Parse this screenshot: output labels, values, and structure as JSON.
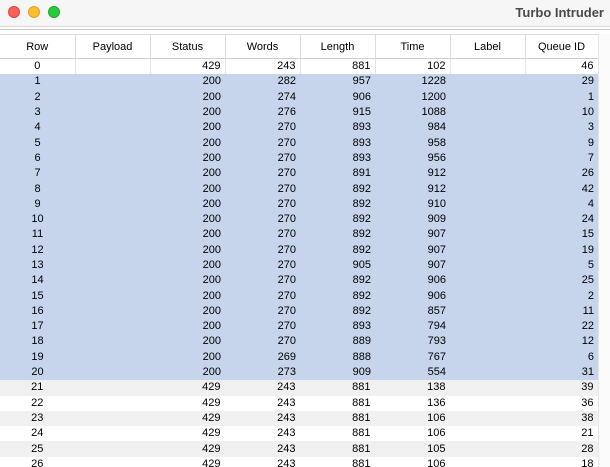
{
  "window": {
    "title": "Turbo Intruder"
  },
  "table": {
    "columns": [
      "Row",
      "Payload",
      "Status",
      "Words",
      "Length",
      "Time",
      "Label",
      "Queue ID"
    ],
    "rows": [
      {
        "row": "0",
        "payload": "",
        "status": "429",
        "words": "243",
        "length": "881",
        "time": "102",
        "label": "",
        "queue_id": "46",
        "selected": false
      },
      {
        "row": "1",
        "payload": "",
        "status": "200",
        "words": "282",
        "length": "957",
        "time": "1228",
        "label": "",
        "queue_id": "29",
        "selected": true
      },
      {
        "row": "2",
        "payload": "",
        "status": "200",
        "words": "274",
        "length": "906",
        "time": "1200",
        "label": "",
        "queue_id": "1",
        "selected": true
      },
      {
        "row": "3",
        "payload": "",
        "status": "200",
        "words": "276",
        "length": "915",
        "time": "1088",
        "label": "",
        "queue_id": "10",
        "selected": true
      },
      {
        "row": "4",
        "payload": "",
        "status": "200",
        "words": "270",
        "length": "893",
        "time": "984",
        "label": "",
        "queue_id": "3",
        "selected": true
      },
      {
        "row": "5",
        "payload": "",
        "status": "200",
        "words": "270",
        "length": "893",
        "time": "958",
        "label": "",
        "queue_id": "9",
        "selected": true
      },
      {
        "row": "6",
        "payload": "",
        "status": "200",
        "words": "270",
        "length": "893",
        "time": "956",
        "label": "",
        "queue_id": "7",
        "selected": true
      },
      {
        "row": "7",
        "payload": "",
        "status": "200",
        "words": "270",
        "length": "891",
        "time": "912",
        "label": "",
        "queue_id": "26",
        "selected": true
      },
      {
        "row": "8",
        "payload": "",
        "status": "200",
        "words": "270",
        "length": "892",
        "time": "912",
        "label": "",
        "queue_id": "42",
        "selected": true
      },
      {
        "row": "9",
        "payload": "",
        "status": "200",
        "words": "270",
        "length": "892",
        "time": "910",
        "label": "",
        "queue_id": "4",
        "selected": true
      },
      {
        "row": "10",
        "payload": "",
        "status": "200",
        "words": "270",
        "length": "892",
        "time": "909",
        "label": "",
        "queue_id": "24",
        "selected": true
      },
      {
        "row": "11",
        "payload": "",
        "status": "200",
        "words": "270",
        "length": "892",
        "time": "907",
        "label": "",
        "queue_id": "15",
        "selected": true
      },
      {
        "row": "12",
        "payload": "",
        "status": "200",
        "words": "270",
        "length": "892",
        "time": "907",
        "label": "",
        "queue_id": "19",
        "selected": true
      },
      {
        "row": "13",
        "payload": "",
        "status": "200",
        "words": "270",
        "length": "905",
        "time": "907",
        "label": "",
        "queue_id": "5",
        "selected": true
      },
      {
        "row": "14",
        "payload": "",
        "status": "200",
        "words": "270",
        "length": "892",
        "time": "906",
        "label": "",
        "queue_id": "25",
        "selected": true
      },
      {
        "row": "15",
        "payload": "",
        "status": "200",
        "words": "270",
        "length": "892",
        "time": "906",
        "label": "",
        "queue_id": "2",
        "selected": true
      },
      {
        "row": "16",
        "payload": "",
        "status": "200",
        "words": "270",
        "length": "892",
        "time": "857",
        "label": "",
        "queue_id": "11",
        "selected": true
      },
      {
        "row": "17",
        "payload": "",
        "status": "200",
        "words": "270",
        "length": "893",
        "time": "794",
        "label": "",
        "queue_id": "22",
        "selected": true
      },
      {
        "row": "18",
        "payload": "",
        "status": "200",
        "words": "270",
        "length": "889",
        "time": "793",
        "label": "",
        "queue_id": "12",
        "selected": true
      },
      {
        "row": "19",
        "payload": "",
        "status": "200",
        "words": "269",
        "length": "888",
        "time": "767",
        "label": "",
        "queue_id": "6",
        "selected": true
      },
      {
        "row": "20",
        "payload": "",
        "status": "200",
        "words": "273",
        "length": "909",
        "time": "554",
        "label": "",
        "queue_id": "31",
        "selected": true
      },
      {
        "row": "21",
        "payload": "",
        "status": "429",
        "words": "243",
        "length": "881",
        "time": "138",
        "label": "",
        "queue_id": "39",
        "selected": false
      },
      {
        "row": "22",
        "payload": "",
        "status": "429",
        "words": "243",
        "length": "881",
        "time": "136",
        "label": "",
        "queue_id": "36",
        "selected": false
      },
      {
        "row": "23",
        "payload": "",
        "status": "429",
        "words": "243",
        "length": "881",
        "time": "106",
        "label": "",
        "queue_id": "38",
        "selected": false
      },
      {
        "row": "24",
        "payload": "",
        "status": "429",
        "words": "243",
        "length": "881",
        "time": "106",
        "label": "",
        "queue_id": "21",
        "selected": false
      },
      {
        "row": "25",
        "payload": "",
        "status": "429",
        "words": "243",
        "length": "881",
        "time": "105",
        "label": "",
        "queue_id": "28",
        "selected": false
      },
      {
        "row": "26",
        "payload": "",
        "status": "429",
        "words": "243",
        "length": "881",
        "time": "106",
        "label": "",
        "queue_id": "18",
        "selected": false
      }
    ]
  },
  "colors": {
    "selected_row": "#c6d5ec",
    "stripe_row": "#f0f0f0",
    "close": "#fe5f57",
    "minimize": "#febc2e",
    "zoom": "#28c840"
  }
}
